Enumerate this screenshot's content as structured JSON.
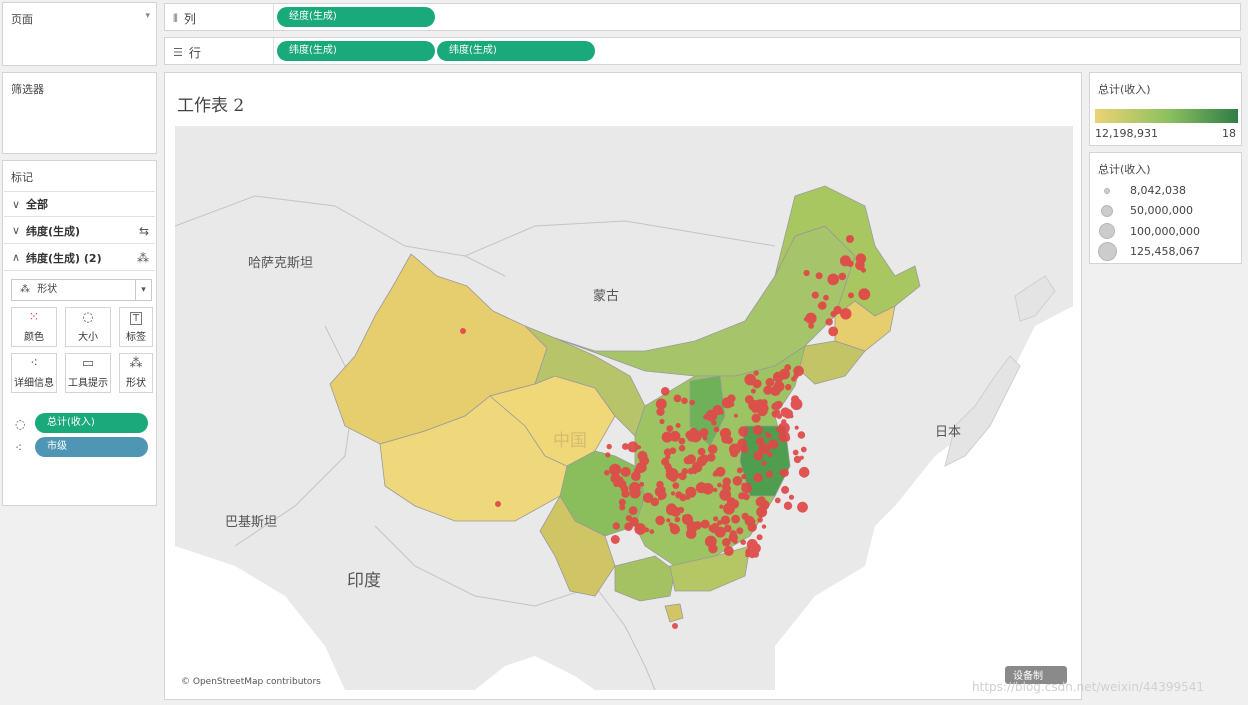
{
  "pages_panel": {
    "title": "页面"
  },
  "shelves": {
    "columns": {
      "label": "列",
      "pills": [
        "经度(生成)"
      ]
    },
    "rows": {
      "label": "行",
      "pills": [
        "纬度(生成)",
        "纬度(生成)"
      ]
    }
  },
  "filters_panel": {
    "title": "筛选器"
  },
  "marks_panel": {
    "title": "标记",
    "cards": [
      {
        "label": "全部",
        "expanded": true
      },
      {
        "label": "纬度(生成)",
        "expanded": true
      },
      {
        "label": "纬度(生成) (2)",
        "expanded": false
      }
    ],
    "mark_type": "形状",
    "buttons": [
      "颜色",
      "大小",
      "标签",
      "详细信息",
      "工具提示",
      "形状"
    ],
    "pills": [
      {
        "label": "总计(收入)",
        "role": "size"
      },
      {
        "label": "市级",
        "role": "detail"
      }
    ]
  },
  "worksheet": {
    "title": "工作表 2",
    "map_labels": [
      "哈萨克斯坦",
      "蒙古",
      "中国",
      "日本",
      "巴基斯坦",
      "印度"
    ],
    "attribution": "© OpenStreetMap contributors",
    "badge": "设备制"
  },
  "color_legend": {
    "title": "总计(收入)",
    "min_label": "12,198,931",
    "max_label": "18",
    "colors": {
      "low": "#ecd374",
      "mid": "#8fc160",
      "high": "#2f7d47"
    }
  },
  "size_legend": {
    "title": "总计(收入)",
    "entries": [
      "8,042,038",
      "50,000,000",
      "100,000,000",
      "125,458,067"
    ]
  },
  "watermark": "https://blog.csdn.net/weixin/44399541",
  "colors": {
    "pill_green": "#1aa97a",
    "pill_blue": "#4e96b3",
    "point_red": "#e04848"
  }
}
